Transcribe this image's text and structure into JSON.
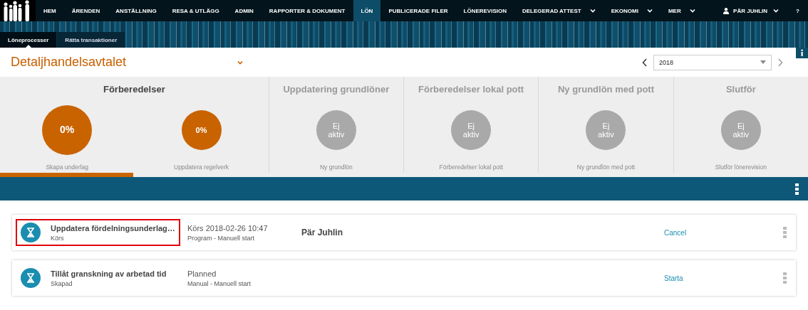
{
  "nav": {
    "items": [
      {
        "label": "HEM",
        "selected": false,
        "dropdown": false
      },
      {
        "label": "ÄRENDEN",
        "selected": false,
        "dropdown": false
      },
      {
        "label": "ANSTÄLLNING",
        "selected": false,
        "dropdown": false
      },
      {
        "label": "RESA & UTLÄGG",
        "selected": false,
        "dropdown": false
      },
      {
        "label": "ADMIN",
        "selected": false,
        "dropdown": false
      },
      {
        "label": "RAPPORTER & DOKUMENT",
        "selected": false,
        "dropdown": false
      },
      {
        "label": "LÖN",
        "selected": true,
        "dropdown": false
      },
      {
        "label": "PUBLICERADE FILER",
        "selected": false,
        "dropdown": false
      },
      {
        "label": "LÖNEREVISION",
        "selected": false,
        "dropdown": false
      },
      {
        "label": "DELEGERAD ATTEST",
        "selected": false,
        "dropdown": true
      },
      {
        "label": "EKONOMI",
        "selected": false,
        "dropdown": true
      },
      {
        "label": "MER",
        "selected": false,
        "dropdown": true
      }
    ],
    "user": "PÄR JUHLIN",
    "help": "?"
  },
  "subtabs": [
    {
      "label": "Löneprocesser",
      "selected": true
    },
    {
      "label": "Rätta transaktioner",
      "selected": false
    }
  ],
  "agreement": "Detaljhandelsavtalet",
  "year": "2018",
  "stages": [
    {
      "title": "Förberedelser",
      "active": true,
      "steps": [
        {
          "reading": "0%",
          "label": "Skapa underlag",
          "active": true,
          "kind": "large"
        },
        {
          "reading": "0%",
          "label": "Uppdatera regelverk",
          "active": true,
          "kind": "small"
        }
      ]
    },
    {
      "title": "Uppdatering grundlöner",
      "active": false,
      "steps": [
        {
          "reading": "Ej aktiv",
          "label": "Ny grundlön",
          "active": false,
          "kind": "small"
        }
      ]
    },
    {
      "title": "Förberedelser lokal pott",
      "active": false,
      "steps": [
        {
          "reading": "Ej aktiv",
          "label": "Förberedelser lokal pott",
          "active": false,
          "kind": "small"
        }
      ]
    },
    {
      "title": "Ny grundlön med pott",
      "active": false,
      "steps": [
        {
          "reading": "Ej aktiv",
          "label": "Ny grundlön med pott",
          "active": false,
          "kind": "small"
        }
      ]
    },
    {
      "title": "Slutför",
      "active": false,
      "steps": [
        {
          "reading": "Ej aktiv",
          "label": "Slutför lönerevision",
          "active": false,
          "kind": "small"
        }
      ]
    }
  ],
  "progress": {
    "level": 0.165
  },
  "tasks": [
    {
      "title": "Uppdatera fördelningsunderlag…",
      "status": "Körs",
      "schedule": "Körs 2018-02-26 10:47",
      "trigger": "Program - Manuell start",
      "user": "Pär Juhlin",
      "action": "Cancel",
      "highlighted": true
    },
    {
      "title": "Tillåt granskning av arbetad tid",
      "status": "Skapad",
      "schedule": "Planned",
      "trigger": "Manual - Manuell start",
      "action": "Starta",
      "highlighted": false
    }
  ]
}
